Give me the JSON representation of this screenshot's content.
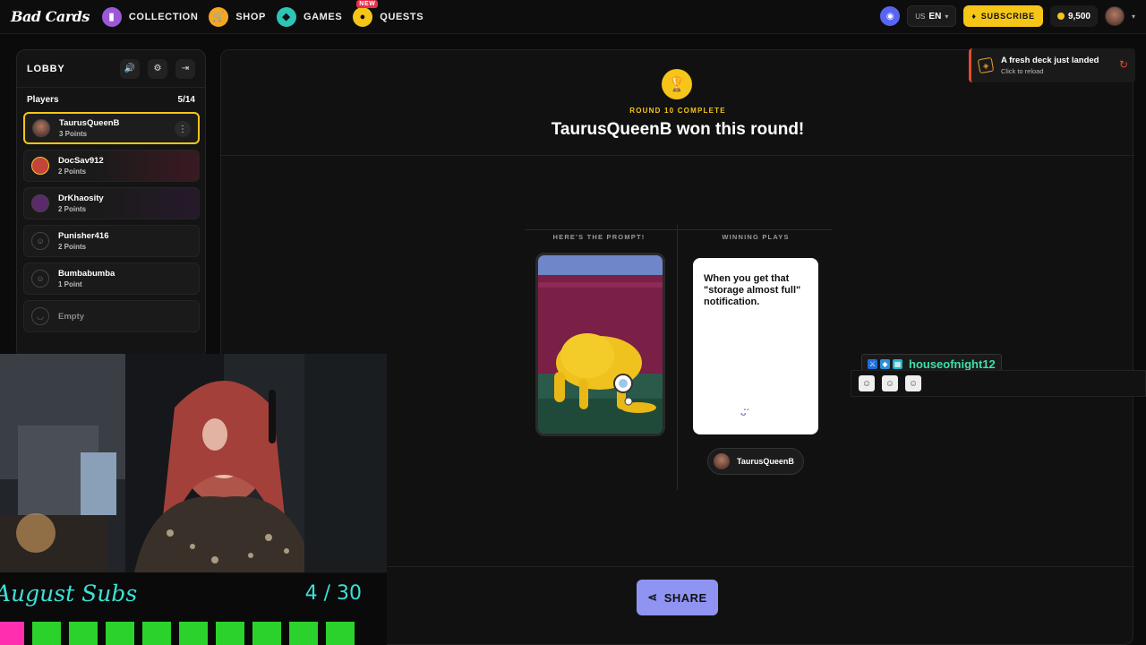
{
  "topbar": {
    "logo": "Bad Cards",
    "nav": [
      {
        "label": "COLLECTION",
        "icon": "cards-icon",
        "color": "#9b59d9"
      },
      {
        "label": "SHOP",
        "icon": "cart-icon",
        "color": "#f5a623"
      },
      {
        "label": "GAMES",
        "icon": "games-icon",
        "color": "#2ec4b6"
      },
      {
        "label": "QUESTS",
        "icon": "quests-icon",
        "color": "#f5c518",
        "badge": "NEW"
      }
    ],
    "lang_country": "US",
    "lang_code": "EN",
    "subscribe_label": "SUBSCRIBE",
    "coins": "9,500"
  },
  "lobby": {
    "title": "LOBBY",
    "players_label": "Players",
    "players_count": "5/14",
    "players": [
      {
        "name": "TaurusQueenB",
        "points": "3 Points"
      },
      {
        "name": "DocSav912",
        "points": "2 Points"
      },
      {
        "name": "DrKhaosity",
        "points": "2 Points"
      },
      {
        "name": "Punisher416",
        "points": "2 Points"
      },
      {
        "name": "Bumbabumba",
        "points": "1 Point"
      }
    ],
    "empty_label": "Empty"
  },
  "round": {
    "status": "ROUND 10 COMPLETE",
    "headline": "TaurusQueenB won this round!",
    "prompt_header": "HERE'S THE PROMPT!",
    "winning_header": "WINNING PLAYS",
    "winning_card_text": "When you get that \"storage almost full\" notification.",
    "winner_name": "TaurusQueenB",
    "share_label": "SHARE"
  },
  "toast": {
    "title": "A fresh deck just landed",
    "subtitle": "Click to reload"
  },
  "chat": {
    "username": "houseofnight12"
  },
  "subs_goal": {
    "label": "August Subs",
    "count": "4 / 30"
  },
  "colors": {
    "accent_yellow": "#f5c518",
    "share_purple": "#8f93f2",
    "chat_green": "#3de0a6",
    "subs_green": "#2cd22c",
    "subs_pink": "#ff2fb0"
  }
}
